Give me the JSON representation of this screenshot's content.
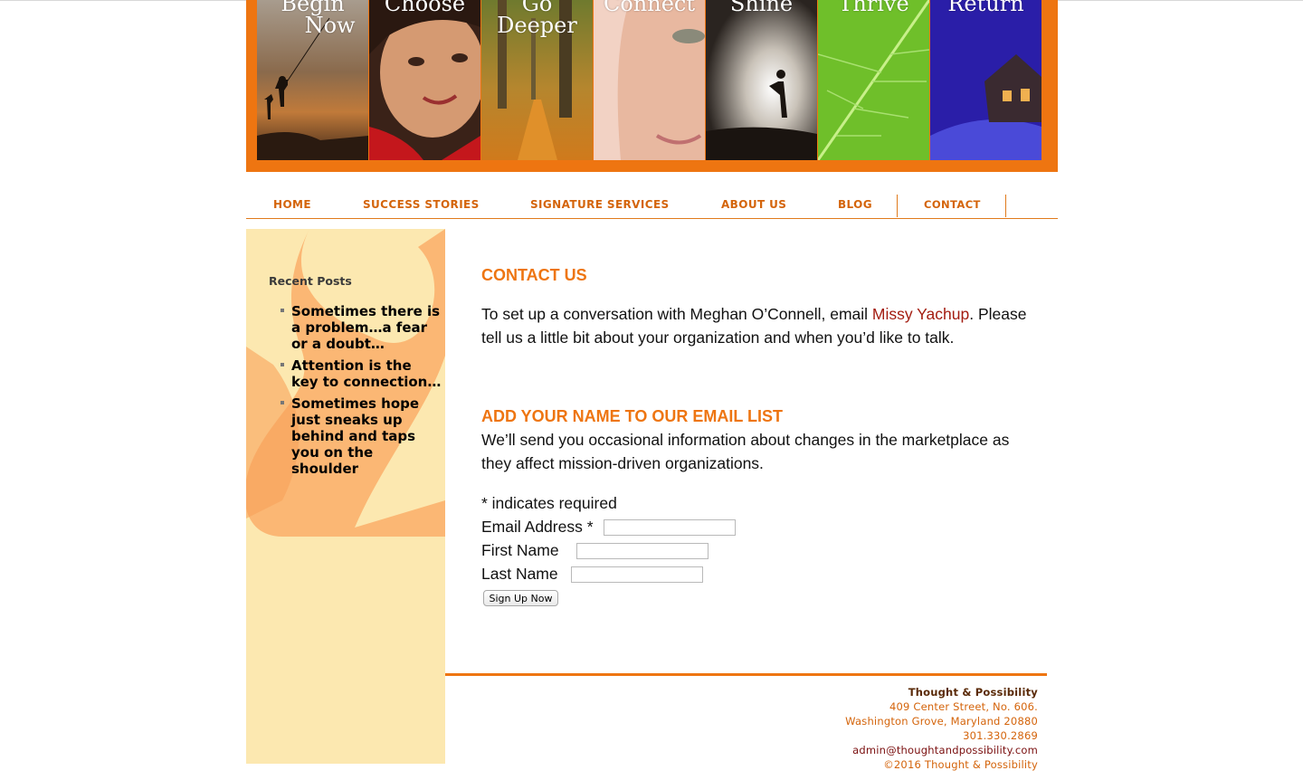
{
  "banner": {
    "panels": [
      {
        "title": "Begin\n     Now"
      },
      {
        "title": "Choose"
      },
      {
        "title": "Go\nDeeper"
      },
      {
        "title": "Connect"
      },
      {
        "title": "Shine"
      },
      {
        "title": "Thrive"
      },
      {
        "title": "Return"
      }
    ]
  },
  "nav": {
    "home": "HOME",
    "success": "SUCCESS STORIES",
    "signature": "SIGNATURE SERVICES",
    "about": "ABOUT US",
    "blog": "BLOG",
    "contact": "CONTACT"
  },
  "sidebar": {
    "heading": "Recent Posts",
    "posts": [
      {
        "label": "Sometimes there is a problem…a fear or a doubt…"
      },
      {
        "label": "Attention is the key to connection…"
      },
      {
        "label": "Sometimes hope just sneaks up behind and taps you on the shoulder"
      }
    ]
  },
  "contact": {
    "heading": "CONTACT US",
    "text_before": "To set up a conversation with Meghan O’Connell, email ",
    "link": "Missy Yachup",
    "text_after": ". Please tell us a little bit about your organization and when you’d like to talk."
  },
  "email_list": {
    "heading": "ADD YOUR NAME TO OUR EMAIL LIST",
    "description": "We’ll send you occasional information about changes in the marketplace as they affect mission-driven organizations.",
    "required_note": "* indicates required",
    "email_label": "Email Address *",
    "email_value": "",
    "first_label": "First Name",
    "first_value": "",
    "last_label": "Last Name",
    "last_value": "",
    "submit": "Sign Up Now"
  },
  "footer": {
    "org": "Thought & Possibility",
    "street": "409 Center Street, No. 606.",
    "city": "Washington Grove, Maryland 20880",
    "phone": "301.330.2869",
    "email": "admin@thoughtandpossibility.com",
    "copyright": "©2016 Thought & Possibility"
  },
  "colors": {
    "brand_orange": "#ee7511",
    "nav_text": "#d4640b",
    "sidebar_bg": "#fce8b0",
    "link_red": "#a31c10",
    "footer_brown": "#5a2a08",
    "footer_orange": "#d4640b",
    "footer_maroon": "#7a0f0f"
  }
}
